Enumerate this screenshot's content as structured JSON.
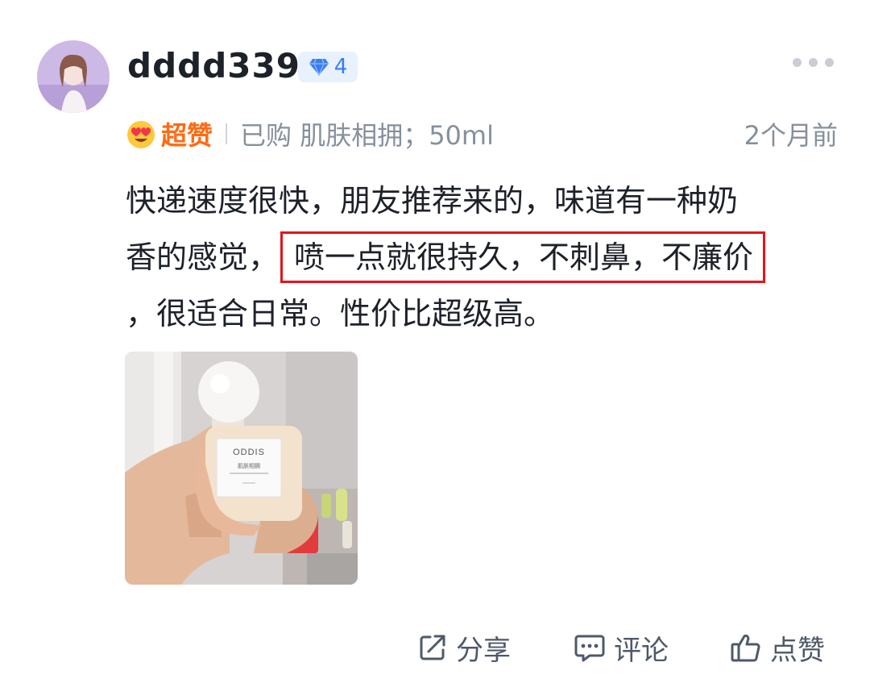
{
  "user": {
    "name": "dddd339",
    "level": "4"
  },
  "review": {
    "rating_label": "超赞",
    "purchase_info": "已购 肌肤相拥；50ml",
    "time": "2个月前",
    "text_line1": "快递速度很快，朋友推荐来的，味道有一种奶",
    "text_line2_prefix": "香的感觉，",
    "text_highlight": "喷一点就很持久，不刺鼻，不廉价",
    "text_line3": "，很适合日常。性价比超级高。"
  },
  "photo": {
    "brand": "ODDIS",
    "product_name": "肌肤相拥"
  },
  "actions": {
    "share": "分享",
    "comment": "评论",
    "like": "点赞"
  },
  "colors": {
    "accent_orange": "#ff6a13",
    "level_blue": "#3a7cf6",
    "highlight_red": "#e5141b",
    "muted": "#86909c"
  },
  "icons": {
    "level": "diamond-icon",
    "more": "more-dots-icon",
    "rating": "heart-eyes-emoji-icon",
    "share": "share-icon",
    "comment": "comment-icon",
    "like": "thumbs-up-icon"
  }
}
